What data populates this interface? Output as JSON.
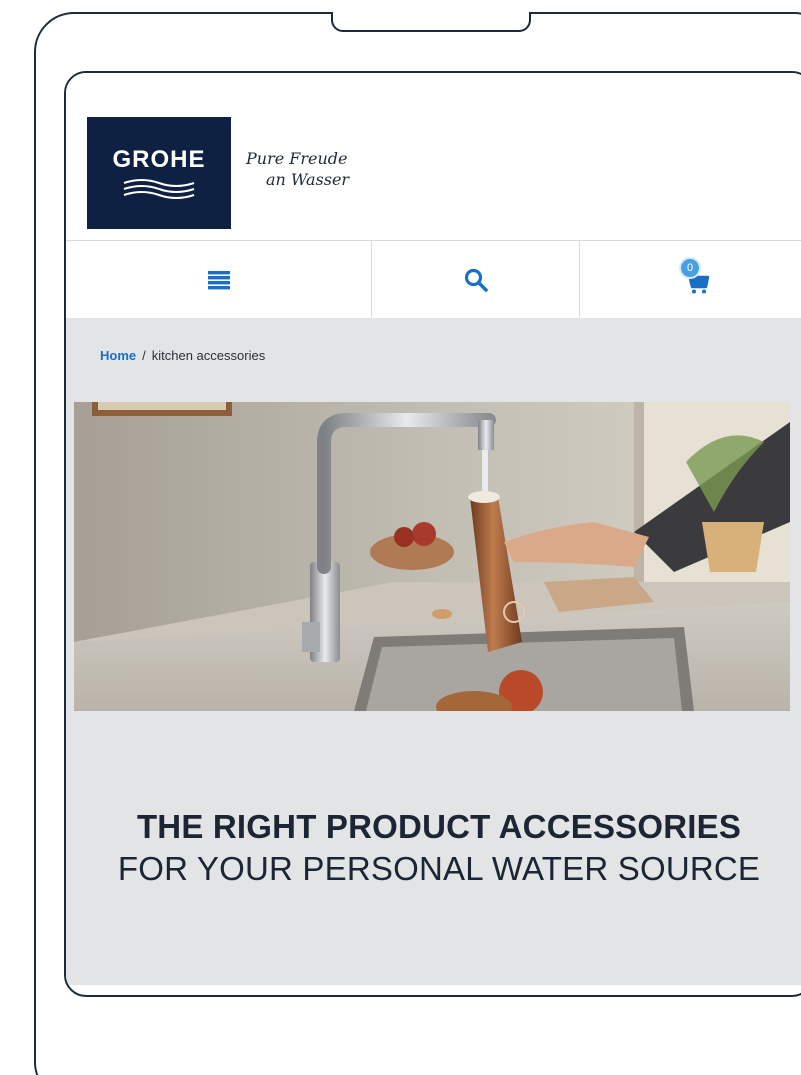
{
  "brand": {
    "logo_text": "GROHE",
    "tagline_line1": "Pure Freude",
    "tagline_line2": "an Wasser",
    "navy": "#0f2142",
    "accent_blue": "#1a6fc4"
  },
  "nav": {
    "menu_icon": "hamburger-menu-icon",
    "search_icon": "search-icon",
    "cart_icon": "shopping-cart-icon",
    "cart_count": "0"
  },
  "breadcrumb": {
    "home": "Home",
    "separator": "/",
    "current": "kitchen accessories"
  },
  "hero": {
    "image_description": "kitchen-faucet-filling-copper-bottle-photo"
  },
  "headline": {
    "line1": "THE RIGHT PRODUCT ACCESSORIES",
    "line2": "FOR YOUR PERSONAL WATER SOURCE"
  }
}
